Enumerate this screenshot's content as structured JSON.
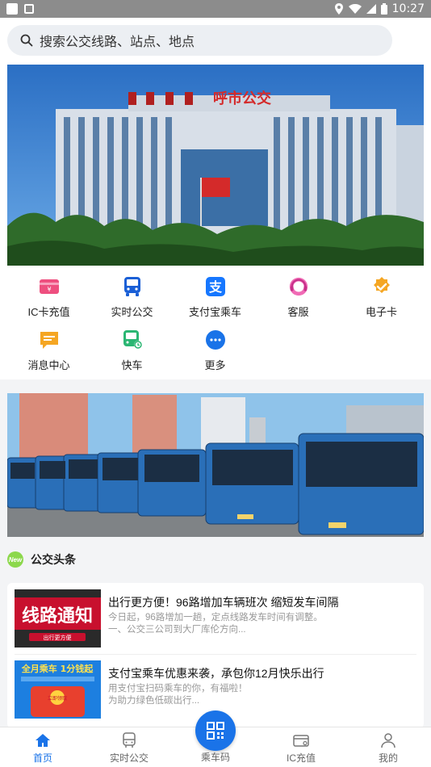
{
  "status_bar": {
    "time": "10:27"
  },
  "search": {
    "placeholder": "搜索公交线路、站点、地点"
  },
  "banner": {
    "sign_text": "呼市公交"
  },
  "quick_menu": [
    {
      "label": "IC卡充值",
      "icon": "card-icon",
      "color": "#ee4f7f"
    },
    {
      "label": "实时公交",
      "icon": "bus-icon",
      "color": "#1a5fd6"
    },
    {
      "label": "支付宝乘车",
      "icon": "alipay-icon",
      "color": "#1677ff"
    },
    {
      "label": "客服",
      "icon": "headset-icon",
      "color": "#e0479e"
    },
    {
      "label": "电子卡",
      "icon": "verified-icon",
      "color": "#f5a623"
    },
    {
      "label": "消息中心",
      "icon": "message-icon",
      "color": "#f5a623"
    },
    {
      "label": "快车",
      "icon": "express-bus-icon",
      "color": "#2bb673"
    },
    {
      "label": "更多",
      "icon": "more-icon",
      "color": "#1a73e8"
    }
  ],
  "news": {
    "section_title": "公交头条",
    "badge": "New",
    "items": [
      {
        "title": "出行更方便！96路增加车辆班次 缩短发车间隔",
        "desc": "今日起，96路增加一趟，定点线路发车时间有调整。\n一、公交三公司到大厂库伦方向...",
        "thumb_text": "线路通知",
        "thumb_sub": "出行更方便"
      },
      {
        "title": "支付宝乘车优惠来袭，承包你12月快乐出行",
        "desc": "用支付宝扫码乘车的你，有福啦！\n为助力绿色低碳出行...",
        "thumb_text": "全月乘车 1分钱起",
        "thumb_sub": "立即领取"
      }
    ]
  },
  "tabbar": {
    "home": "首页",
    "realtime": "实时公交",
    "ride_code": "乘车码",
    "ic_recharge": "IC充值",
    "mine": "我的"
  }
}
